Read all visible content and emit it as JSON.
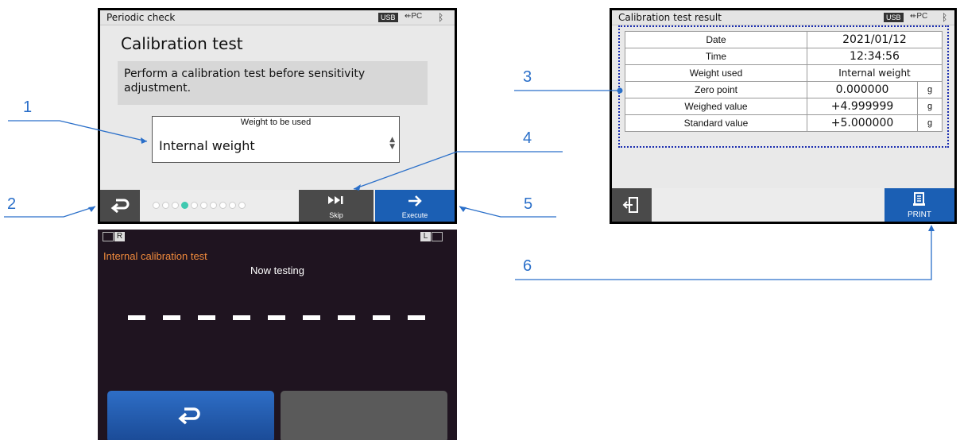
{
  "screen1": {
    "status_title": "Periodic check",
    "usb_label": "USB",
    "pc_label": "PC",
    "title": "Calibration test",
    "message": "Perform a calibration test before sensitivity adjustment.",
    "weight_label": "Weight to be used",
    "weight_value": "Internal weight",
    "skip_label": "Skip",
    "execute_label": "Execute",
    "progress": {
      "total": 10,
      "current": 4
    }
  },
  "screen2": {
    "status_title": "Calibration test result",
    "usb_label": "USB",
    "pc_label": "PC",
    "rows": [
      {
        "label": "Date",
        "value": "2021/01/12",
        "unit": ""
      },
      {
        "label": "Time",
        "value": "12:34:56",
        "unit": ""
      },
      {
        "label": "Weight used",
        "value": "Internal weight",
        "unit": ""
      },
      {
        "label": "Zero point",
        "value": "0.000000",
        "unit": "g"
      },
      {
        "label": "Weighed value",
        "value": "+4.999999",
        "unit": "g"
      },
      {
        "label": "Standard value",
        "value": "+5.000000",
        "unit": "g"
      }
    ],
    "print_label": "PRINT"
  },
  "screen3": {
    "left_indicator": "R",
    "right_indicator": "L",
    "mode_title": "Internal calibration test",
    "status": "Now testing"
  },
  "callouts": [
    "1",
    "2",
    "3",
    "4",
    "5",
    "6"
  ],
  "colors": {
    "accent_blue": "#1b5fb4",
    "callout_blue": "#2a6fc9",
    "progress_active": "#3fc9b0",
    "mode_orange": "#f08a3c"
  }
}
